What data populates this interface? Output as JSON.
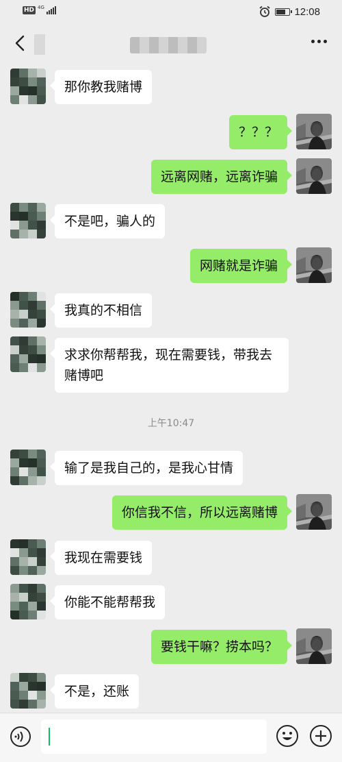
{
  "status_bar": {
    "hd": "HD",
    "network": "4G",
    "time": "12:08",
    "battery_level": 0.75
  },
  "title_bar": {
    "back_icon": "chevron-left-icon",
    "more_icon": "more-dots-icon"
  },
  "colors": {
    "background": "#ededed",
    "sent_bubble": "#95ec69",
    "received_bubble": "#ffffff",
    "caret": "#07c160"
  },
  "messages": [
    {
      "side": "left",
      "text": "那你教我赌博"
    },
    {
      "side": "right",
      "text": "？？？"
    },
    {
      "side": "right",
      "text": "远离网赌，远离诈骗"
    },
    {
      "side": "left",
      "text": "不是吧，骗人的"
    },
    {
      "side": "right",
      "text": "网赌就是诈骗"
    },
    {
      "side": "left",
      "text": "我真的不相信"
    },
    {
      "side": "left",
      "text": "求求你帮帮我，现在需要钱，带我去赌博吧"
    },
    {
      "side": "left",
      "text": "输了是我自己的，是我心甘情"
    },
    {
      "side": "right",
      "text": "你信我不信，所以远离赌博"
    },
    {
      "side": "left",
      "text": "我现在需要钱"
    },
    {
      "side": "left",
      "text": "你能不能帮帮我"
    },
    {
      "side": "right",
      "text": "要钱干嘛？捞本吗？"
    },
    {
      "side": "left",
      "text": "不是，还账"
    }
  ],
  "timestamp": "上午10:47",
  "input_bar": {
    "voice_icon": "voice-icon",
    "emoji_icon": "emoji-icon",
    "plus_icon": "plus-icon",
    "value": ""
  }
}
